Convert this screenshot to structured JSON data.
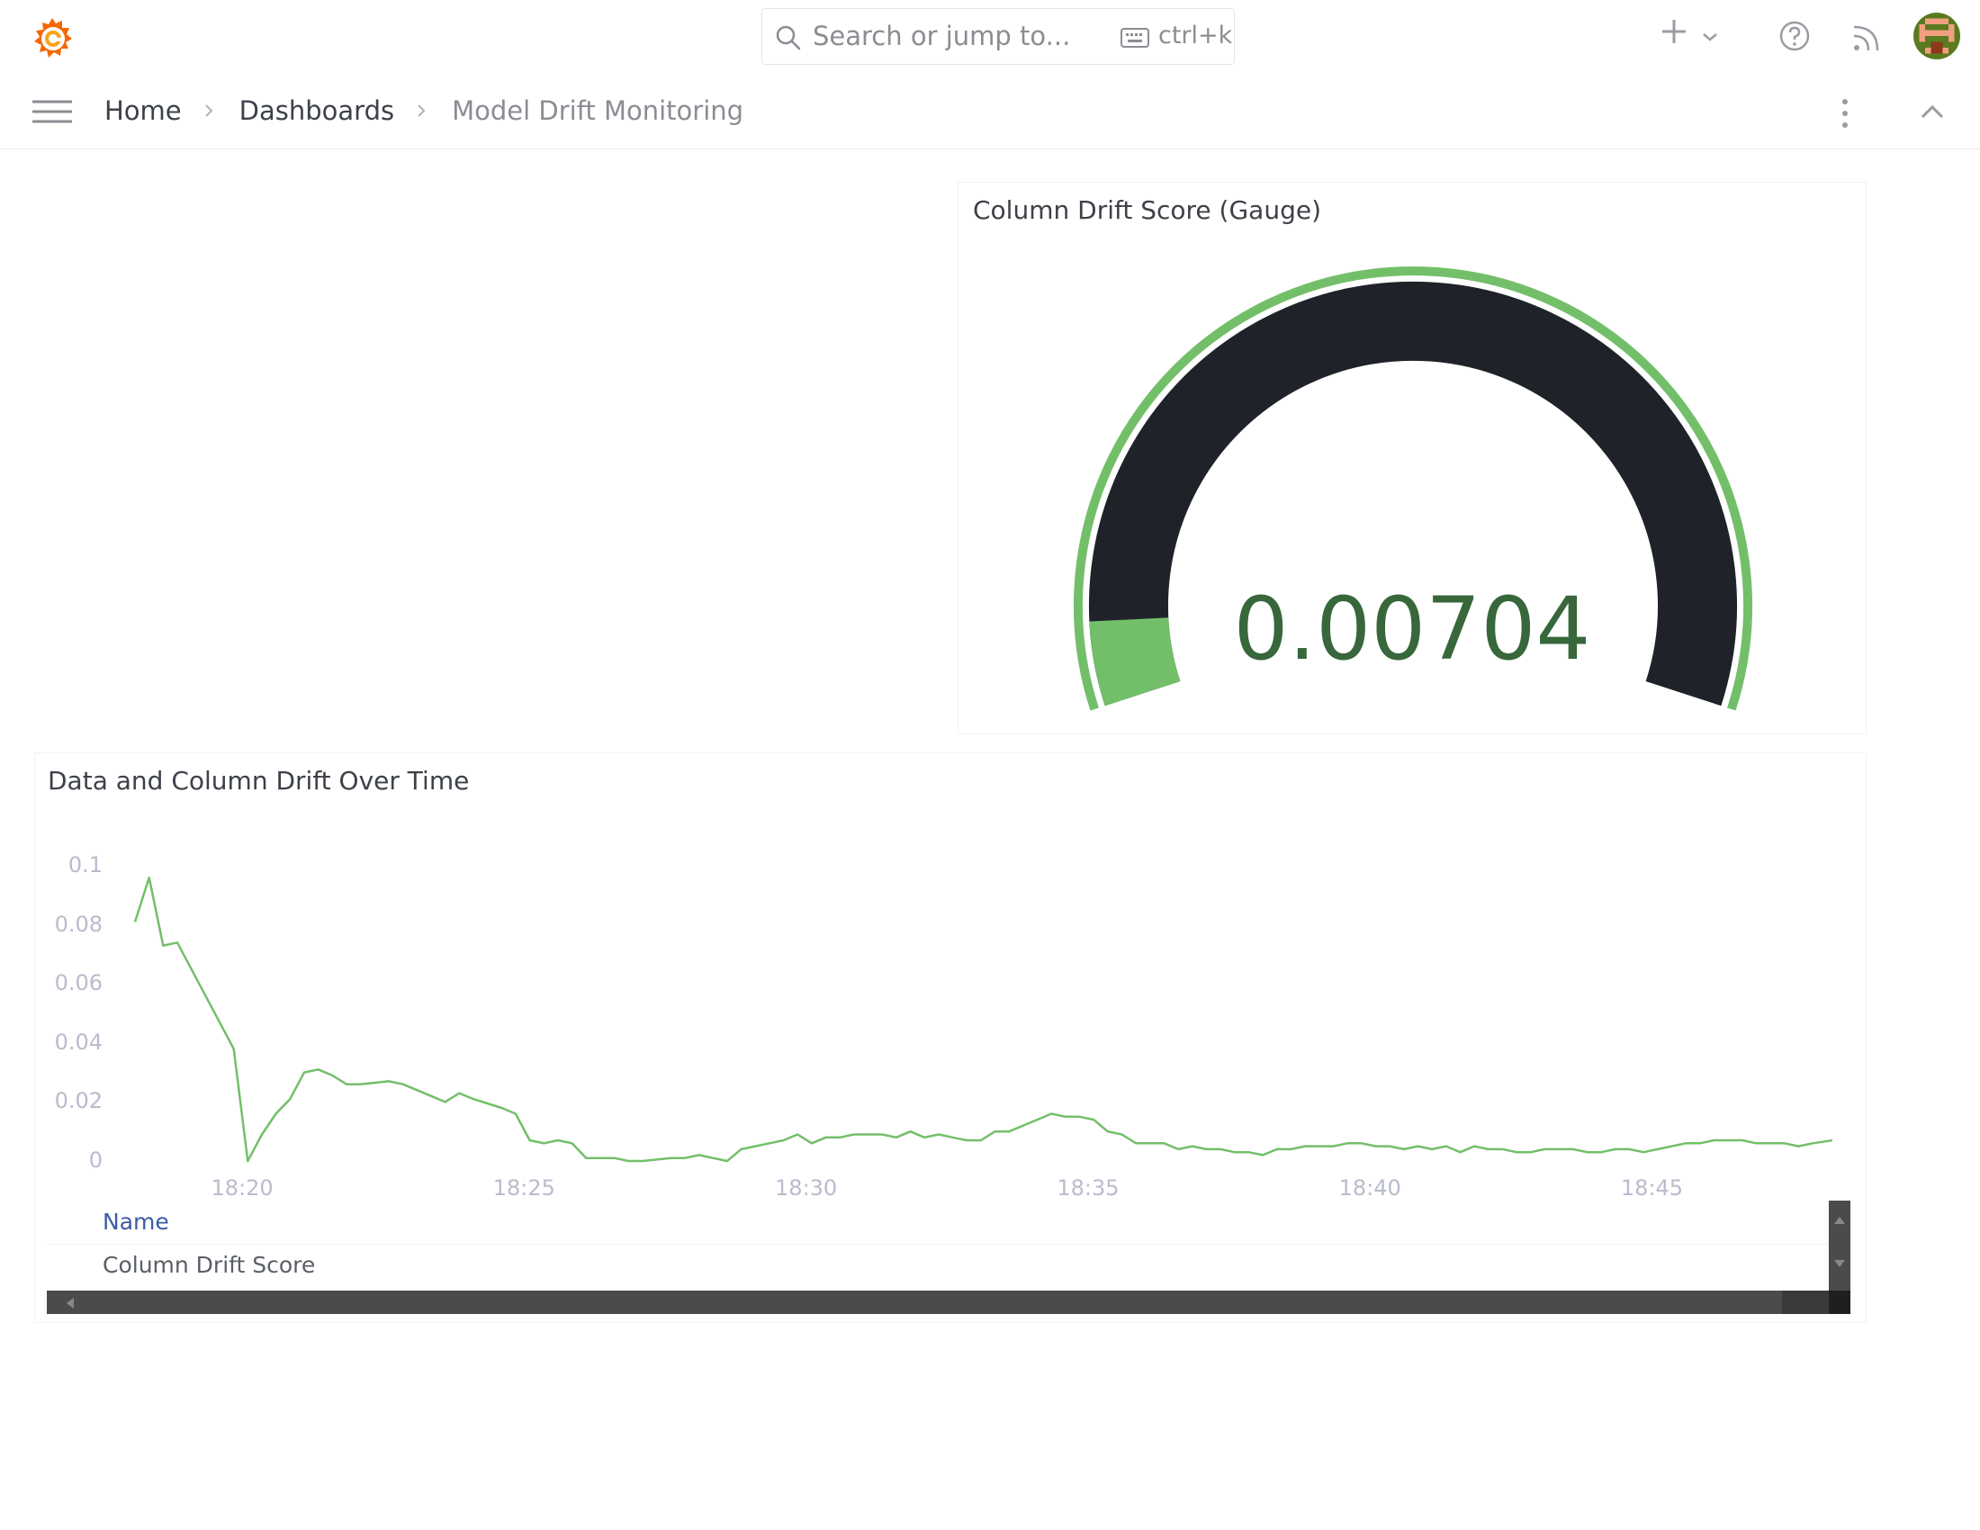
{
  "header": {
    "search_placeholder": "Search or jump to...",
    "search_shortcut": "ctrl+k"
  },
  "breadcrumb": {
    "items": [
      "Home",
      "Dashboards",
      "Model Drift Monitoring"
    ]
  },
  "gauge_panel": {
    "title": "Column Drift Score (Gauge)",
    "value": "0.00704",
    "min": 0,
    "max": 0.1,
    "colors": {
      "threshold": "#73bf69",
      "track": "#1f2329",
      "value_text": "#37673b"
    }
  },
  "timeseries_panel": {
    "title": "Data and Column Drift Over Time",
    "legend_header": "Name",
    "legend_series": "Column Drift Score",
    "line_color": "#73bf69"
  },
  "chart_data": {
    "type": "line",
    "title": "Data and Column Drift Over Time",
    "y_ticks": [
      "0",
      "0.02",
      "0.04",
      "0.06",
      "0.08",
      "0.1"
    ],
    "x_ticks": [
      "18:20",
      "18:25",
      "18:30",
      "18:35",
      "18:40",
      "18:45"
    ],
    "ylim": [
      0,
      0.1
    ],
    "x_unit": "minutes past 18:00",
    "xlim": [
      18.1,
      48.2
    ],
    "grid": false,
    "series": [
      {
        "name": "Column Drift Score",
        "color": "#73bf69",
        "points": [
          [
            18.1,
            0.081
          ],
          [
            18.35,
            0.096
          ],
          [
            18.6,
            0.073
          ],
          [
            18.85,
            0.074
          ],
          [
            19.35,
            0.056
          ],
          [
            19.6,
            0.047
          ],
          [
            19.85,
            0.038
          ],
          [
            20.1,
            0.0
          ],
          [
            20.35,
            0.009
          ],
          [
            20.6,
            0.016
          ],
          [
            20.85,
            0.021
          ],
          [
            21.1,
            0.03
          ],
          [
            21.35,
            0.031
          ],
          [
            21.6,
            0.029
          ],
          [
            21.85,
            0.026
          ],
          [
            22.1,
            0.026
          ],
          [
            22.6,
            0.027
          ],
          [
            22.85,
            0.026
          ],
          [
            23.35,
            0.022
          ],
          [
            23.6,
            0.02
          ],
          [
            23.85,
            0.023
          ],
          [
            24.1,
            0.021
          ],
          [
            24.6,
            0.018
          ],
          [
            24.85,
            0.016
          ],
          [
            25.1,
            0.007
          ],
          [
            25.35,
            0.006
          ],
          [
            25.6,
            0.007
          ],
          [
            25.85,
            0.006
          ],
          [
            26.1,
            0.001
          ],
          [
            26.6,
            0.001
          ],
          [
            26.85,
            0.0
          ],
          [
            27.1,
            0.0
          ],
          [
            27.6,
            0.001
          ],
          [
            27.85,
            0.001
          ],
          [
            28.1,
            0.002
          ],
          [
            28.35,
            0.001
          ],
          [
            28.6,
            0.0
          ],
          [
            28.85,
            0.004
          ],
          [
            29.1,
            0.005
          ],
          [
            29.35,
            0.006
          ],
          [
            29.6,
            0.007
          ],
          [
            29.85,
            0.009
          ],
          [
            30.1,
            0.006
          ],
          [
            30.35,
            0.008
          ],
          [
            30.6,
            0.008
          ],
          [
            30.85,
            0.009
          ],
          [
            31.35,
            0.009
          ],
          [
            31.6,
            0.008
          ],
          [
            31.85,
            0.01
          ],
          [
            32.1,
            0.008
          ],
          [
            32.35,
            0.009
          ],
          [
            32.6,
            0.008
          ],
          [
            32.85,
            0.007
          ],
          [
            33.1,
            0.007
          ],
          [
            33.35,
            0.01
          ],
          [
            33.6,
            0.01
          ],
          [
            33.85,
            0.012
          ],
          [
            34.1,
            0.014
          ],
          [
            34.35,
            0.016
          ],
          [
            34.6,
            0.015
          ],
          [
            34.85,
            0.015
          ],
          [
            35.1,
            0.014
          ],
          [
            35.35,
            0.01
          ],
          [
            35.6,
            0.009
          ],
          [
            35.85,
            0.006
          ],
          [
            36.1,
            0.006
          ],
          [
            36.35,
            0.006
          ],
          [
            36.6,
            0.004
          ],
          [
            36.85,
            0.005
          ],
          [
            37.1,
            0.004
          ],
          [
            37.35,
            0.004
          ],
          [
            37.6,
            0.003
          ],
          [
            37.85,
            0.003
          ],
          [
            38.1,
            0.002
          ],
          [
            38.35,
            0.004
          ],
          [
            38.6,
            0.004
          ],
          [
            38.85,
            0.005
          ],
          [
            39.1,
            0.005
          ],
          [
            39.35,
            0.005
          ],
          [
            39.6,
            0.006
          ],
          [
            39.85,
            0.006
          ],
          [
            40.1,
            0.005
          ],
          [
            40.35,
            0.005
          ],
          [
            40.6,
            0.004
          ],
          [
            40.85,
            0.005
          ],
          [
            41.1,
            0.004
          ],
          [
            41.35,
            0.005
          ],
          [
            41.6,
            0.003
          ],
          [
            41.85,
            0.005
          ],
          [
            42.1,
            0.004
          ],
          [
            42.35,
            0.004
          ],
          [
            42.6,
            0.003
          ],
          [
            42.85,
            0.003
          ],
          [
            43.1,
            0.004
          ],
          [
            43.35,
            0.004
          ],
          [
            43.6,
            0.004
          ],
          [
            43.85,
            0.003
          ],
          [
            44.1,
            0.003
          ],
          [
            44.35,
            0.004
          ],
          [
            44.6,
            0.004
          ],
          [
            44.85,
            0.003
          ],
          [
            45.1,
            0.004
          ],
          [
            45.35,
            0.005
          ],
          [
            45.6,
            0.006
          ],
          [
            45.85,
            0.006
          ],
          [
            46.1,
            0.007
          ],
          [
            46.35,
            0.007
          ],
          [
            46.6,
            0.007
          ],
          [
            46.85,
            0.006
          ],
          [
            47.1,
            0.006
          ],
          [
            47.35,
            0.006
          ],
          [
            47.6,
            0.005
          ],
          [
            47.85,
            0.006
          ],
          [
            48.2,
            0.007
          ]
        ]
      }
    ]
  }
}
